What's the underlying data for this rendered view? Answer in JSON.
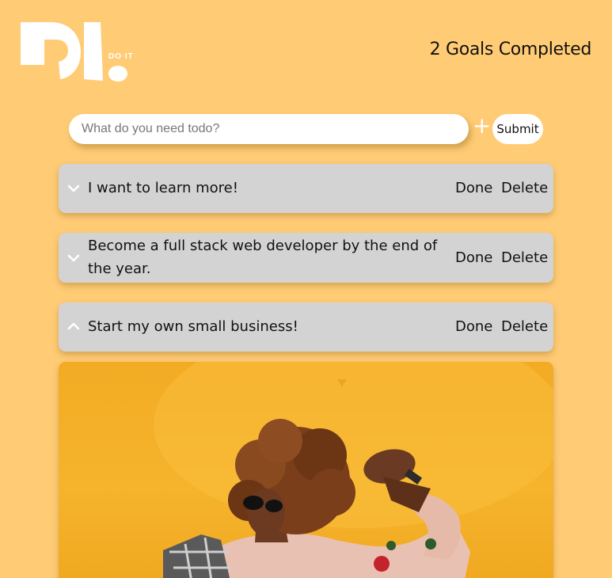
{
  "logo": {
    "alt_text": "DO IT",
    "brand_color": "#ffffff"
  },
  "header": {
    "goals_completed": "2 Goals Completed"
  },
  "form": {
    "placeholder": "What do you need todo?",
    "value": "",
    "add_icon": "plus-icon",
    "submit_label": "Submit"
  },
  "todos": [
    {
      "text": "I want to learn more!",
      "expanded": false,
      "chevron_icon": "chevron-down-icon",
      "done_label": "Done",
      "delete_label": "Delete"
    },
    {
      "text": "Become a full stack web developer by the end of the year.",
      "expanded": false,
      "chevron_icon": "chevron-down-icon",
      "done_label": "Done",
      "delete_label": "Delete"
    },
    {
      "text": "Start my own small business!",
      "expanded": true,
      "chevron_icon": "chevron-up-icon",
      "done_label": "Done",
      "delete_label": "Delete",
      "image": "photo of a dancing person with curly hair on an orange background"
    }
  ],
  "colors": {
    "background": "#ffcb75",
    "card": "#d3d3d3",
    "input": "#ffffff"
  }
}
